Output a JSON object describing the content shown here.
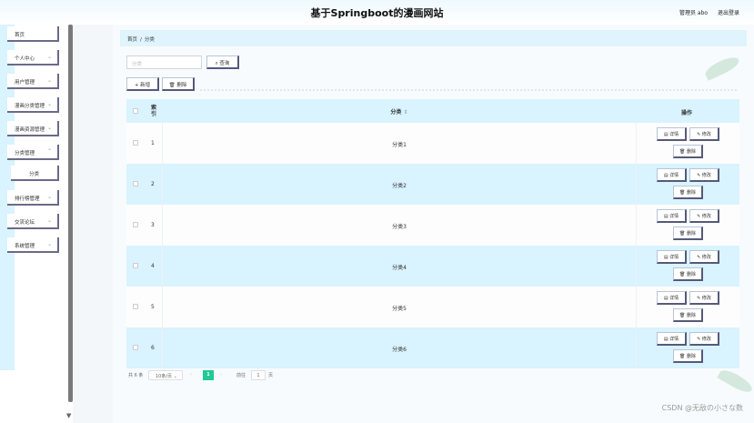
{
  "header": {
    "site_title": "基于Springboot的漫画网站",
    "user_label": "管理员 abo",
    "logout_label": "退出登录"
  },
  "sidebar": {
    "items": [
      {
        "label": "首页",
        "has_children": false
      },
      {
        "label": "个人中心",
        "has_children": true
      },
      {
        "label": "用户管理",
        "has_children": true
      },
      {
        "label": "漫画分类管理",
        "has_children": true
      },
      {
        "label": "漫画资源管理",
        "has_children": true
      },
      {
        "label": "分类管理",
        "has_children": true,
        "expanded": true
      },
      {
        "label": "分类",
        "is_sub": true
      },
      {
        "label": "排行榜管理",
        "has_children": true
      },
      {
        "label": "交流论坛",
        "has_children": true
      },
      {
        "label": "系统管理",
        "has_children": true
      }
    ]
  },
  "breadcrumb": {
    "home": "首页",
    "separator": "/",
    "current": "分类"
  },
  "search": {
    "placeholder": "分类",
    "button_label": "查询"
  },
  "toolbar": {
    "add_label": "新增",
    "delete_label": "删除"
  },
  "table": {
    "headers": {
      "index": "索引",
      "name": "分类",
      "actions": "操作"
    },
    "rows": [
      {
        "index": "1",
        "name": "分类1"
      },
      {
        "index": "2",
        "name": "分类2"
      },
      {
        "index": "3",
        "name": "分类3"
      },
      {
        "index": "4",
        "name": "分类4"
      },
      {
        "index": "5",
        "name": "分类5"
      },
      {
        "index": "6",
        "name": "分类6"
      }
    ],
    "row_actions": {
      "detail": "详情",
      "edit": "修改",
      "delete": "删除"
    }
  },
  "pagination": {
    "total": "共 6 条",
    "page_size": "10条/页",
    "current_page": "1",
    "goto_label": "前往",
    "goto_value": "1",
    "page_unit": "页"
  },
  "colors": {
    "accent": "#20c997",
    "row_highlight": "#d9f3ff"
  },
  "watermark": "CSDN @无敌の小さな数"
}
